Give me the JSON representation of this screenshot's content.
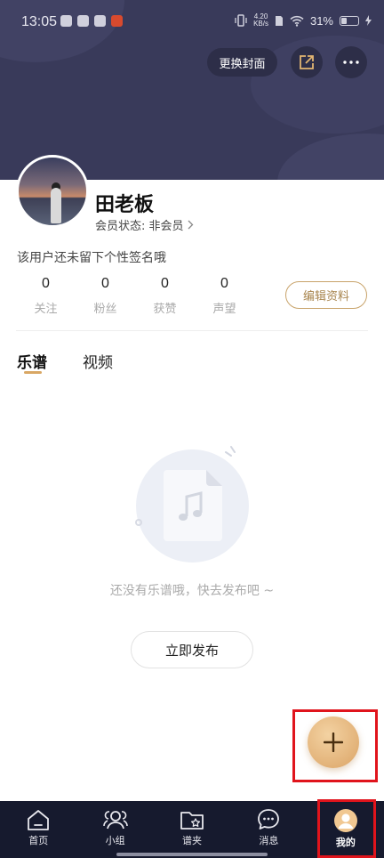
{
  "status_bar": {
    "time": "13:05",
    "network_speed_top": "4.20",
    "network_speed_bottom": "KB/s",
    "battery_percent": "31%"
  },
  "header": {
    "change_cover_label": "更换封面"
  },
  "profile": {
    "name": "田老板",
    "member_status": "会员状态: 非会员",
    "signature": "该用户还未留下个性签名哦",
    "edit_label": "编辑资料",
    "stats": [
      {
        "value": "0",
        "label": "关注"
      },
      {
        "value": "0",
        "label": "粉丝"
      },
      {
        "value": "0",
        "label": "获赞"
      },
      {
        "value": "0",
        "label": "声望"
      }
    ]
  },
  "tabs": [
    {
      "label": "乐谱",
      "active": true
    },
    {
      "label": "视频",
      "active": false
    }
  ],
  "empty_state": {
    "message": "还没有乐谱哦，快去发布吧 ~",
    "button_label": "立即发布"
  },
  "fab": {
    "icon": "plus-icon"
  },
  "bottom_nav": [
    {
      "label": "首页",
      "icon": "home-icon"
    },
    {
      "label": "小组",
      "icon": "group-icon"
    },
    {
      "label": "谱夹",
      "icon": "folder-star-icon"
    },
    {
      "label": "消息",
      "icon": "chat-icon"
    },
    {
      "label": "我的",
      "icon": "user-avatar-icon",
      "active": true
    }
  ],
  "colors": {
    "accent_gold": "#d9a764",
    "cover_bg": "#393a5a",
    "nav_bg": "#161a2e",
    "highlight_red": "#e0141c"
  }
}
